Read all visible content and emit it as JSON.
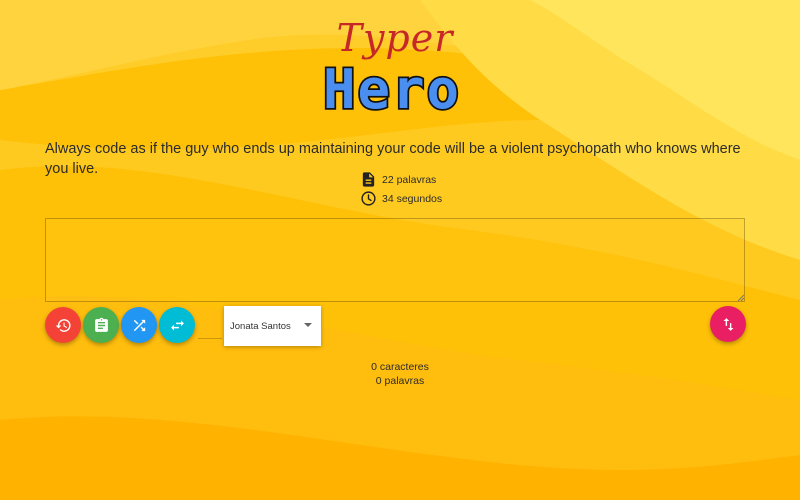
{
  "logo": {
    "top_text": "Typer",
    "bottom_text": "Hero",
    "top_color": "#c62828",
    "bottom_fill": "#4a8ff0",
    "bottom_outline": "#111111"
  },
  "quote": {
    "text": "Always code as if the guy who ends up maintaining your code will be a violent psychopath who knows where you live."
  },
  "stats": {
    "words": "22 palavras",
    "words_icon": "document-icon",
    "time": "34 segundos",
    "time_icon": "clock-icon"
  },
  "typing_area": {
    "value": "",
    "placeholder": ""
  },
  "actions": [
    {
      "name": "history",
      "icon": "history-icon",
      "color": "#f44336"
    },
    {
      "name": "clipboard",
      "icon": "clipboard-icon",
      "color": "#4caf50"
    },
    {
      "name": "shuffle",
      "icon": "shuffle-icon",
      "color": "#2196f3"
    },
    {
      "name": "swap",
      "icon": "swap-icon",
      "color": "#00bcd4"
    },
    {
      "name": "sort",
      "icon": "swap-vertical-icon",
      "color": "#e91e63"
    }
  ],
  "author_select": {
    "selected": "Jonata Santos"
  },
  "counters": {
    "characters": "0 caracteres",
    "words": "0 palavras"
  },
  "theme": {
    "background": "#ffc107",
    "wave_light": "#ffe14f",
    "wave_dark": "#ffb300"
  }
}
